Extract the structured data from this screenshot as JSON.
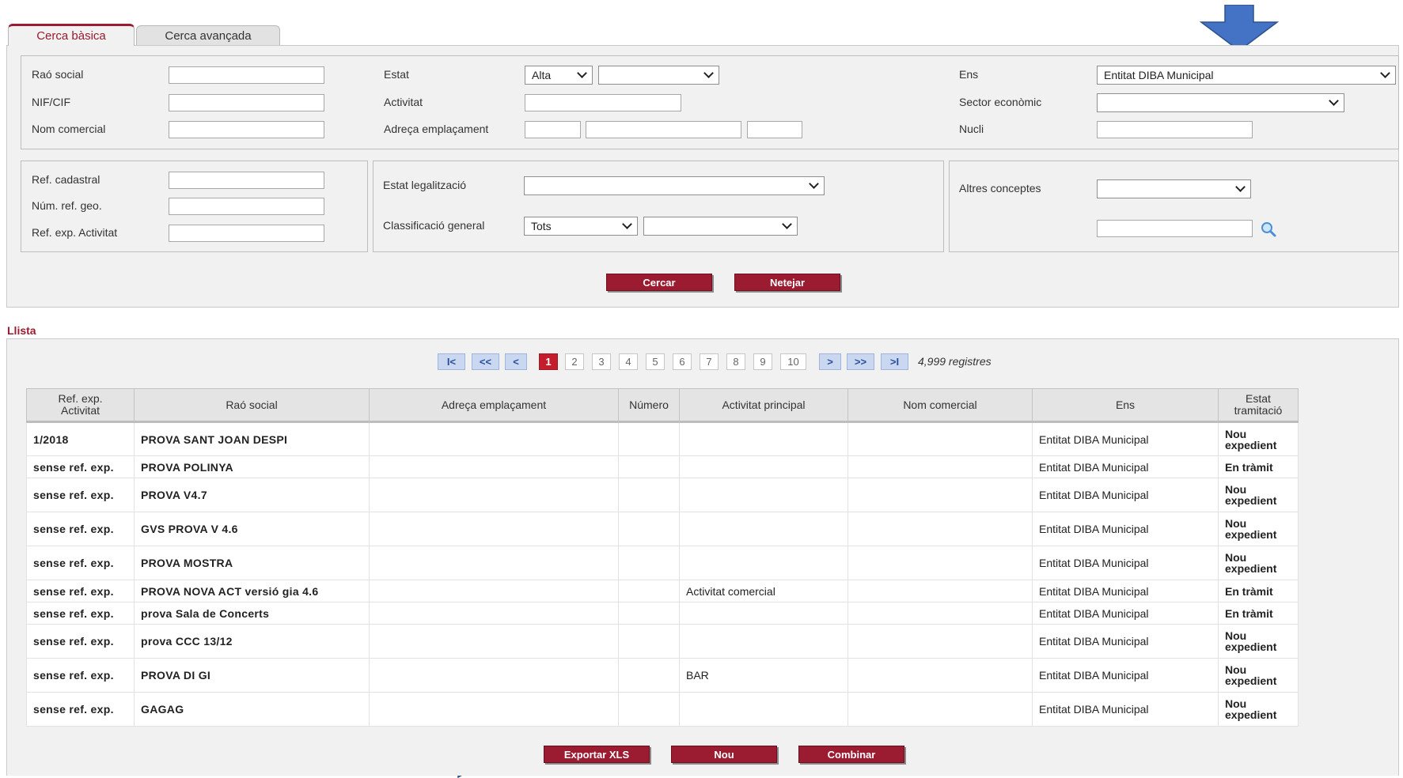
{
  "tabs": {
    "basic": "Cerca bàsica",
    "advanced": "Cerca avançada"
  },
  "filters": {
    "rao_social": "Raó social",
    "nif_cif": "NIF/CIF",
    "nom_comercial": "Nom comercial",
    "estat": "Estat",
    "estat_value": "Alta",
    "estat_sub_value": "",
    "activitat": "Activitat",
    "adreca": "Adreça emplaçament",
    "ens": "Ens",
    "ens_value": "Entitat DIBA Municipal",
    "sector": "Sector econòmic",
    "sector_value": "",
    "nucli": "Nucli",
    "ref_cadastral": "Ref. cadastral",
    "num_ref_geo": "Núm. ref. geo.",
    "ref_exp_activitat": "Ref. exp. Activitat",
    "estat_legalitzacio": "Estat legalització",
    "estat_legalitzacio_value": "",
    "classificacio": "Classificació general",
    "classificacio_value": "Tots",
    "classificacio_sub_value": "",
    "altres": "Altres conceptes",
    "altres_value": ""
  },
  "actions": {
    "search": "Cercar",
    "clear": "Netejar"
  },
  "list": {
    "title": "Llista",
    "pager": {
      "first": "I<",
      "prev_block": "<<",
      "prev": "<",
      "pages": [
        "1",
        "2",
        "3",
        "4",
        "5",
        "6",
        "7",
        "8",
        "9",
        "10"
      ],
      "current": "1",
      "next": ">",
      "next_block": ">>",
      "last": ">I",
      "records": "4,999 registres"
    },
    "columns": {
      "ref_line1": "Ref. exp.",
      "ref_line2": "Activitat",
      "rao_social": "Raó social",
      "adreca": "Adreça emplaçament",
      "numero": "Número",
      "activitat": "Activitat principal",
      "nom_comercial": "Nom comercial",
      "ens": "Ens",
      "estat_line1": "Estat",
      "estat_line2": "tramitació"
    },
    "rows": [
      {
        "ref": "1/2018",
        "rao": "PROVA SANT JOAN DESPI",
        "adreca": "",
        "numero": "",
        "activitat": "",
        "nom": "",
        "ens": "Entitat DIBA Municipal",
        "estat": "Nou expedient"
      },
      {
        "ref": "sense ref. exp.",
        "rao": "PROVA POLINYA",
        "adreca": "",
        "numero": "",
        "activitat": "",
        "nom": "",
        "ens": "Entitat DIBA Municipal",
        "estat": "En tràmit"
      },
      {
        "ref": "sense ref. exp.",
        "rao": "PROVA V4.7",
        "adreca": "",
        "numero": "",
        "activitat": "",
        "nom": "",
        "ens": "Entitat DIBA Municipal",
        "estat": "Nou expedient"
      },
      {
        "ref": "sense ref. exp.",
        "rao": "GVS PROVA V 4.6",
        "adreca": "",
        "numero": "",
        "activitat": "",
        "nom": "",
        "ens": "Entitat DIBA Municipal",
        "estat": "Nou expedient"
      },
      {
        "ref": "sense ref. exp.",
        "rao": "PROVA MOSTRA",
        "adreca": "",
        "numero": "",
        "activitat": "",
        "nom": "",
        "ens": "Entitat DIBA Municipal",
        "estat": "Nou expedient"
      },
      {
        "ref": "sense ref. exp.",
        "rao": "PROVA NOVA ACT versió gia 4.6",
        "adreca": "",
        "numero": "",
        "activitat": "Activitat comercial",
        "nom": "",
        "ens": "Entitat DIBA Municipal",
        "estat": "En tràmit"
      },
      {
        "ref": "sense ref. exp.",
        "rao": "prova Sala de Concerts",
        "adreca": "",
        "numero": "",
        "activitat": "",
        "nom": "",
        "ens": "Entitat DIBA Municipal",
        "estat": "En tràmit"
      },
      {
        "ref": "sense ref. exp.",
        "rao": "prova CCC 13/12",
        "adreca": "",
        "numero": "",
        "activitat": "",
        "nom": "",
        "ens": "Entitat DIBA Municipal",
        "estat": "Nou expedient"
      },
      {
        "ref": "sense ref. exp.",
        "rao": "PROVA DI GI",
        "adreca": "",
        "numero": "",
        "activitat": "BAR",
        "nom": "",
        "ens": "Entitat DIBA Municipal",
        "estat": "Nou expedient"
      },
      {
        "ref": "sense ref. exp.",
        "rao": "GAGAG",
        "adreca": "",
        "numero": "",
        "activitat": "",
        "nom": "",
        "ens": "Entitat DIBA Municipal",
        "estat": "Nou expedient"
      }
    ]
  },
  "bottom_actions": {
    "export": "Exportar XLS",
    "new": "Nou",
    "combine": "Combinar"
  },
  "colors": {
    "accent": "#9b1b30",
    "arrow": "#4472c4",
    "page_current": "#c41e2c"
  }
}
